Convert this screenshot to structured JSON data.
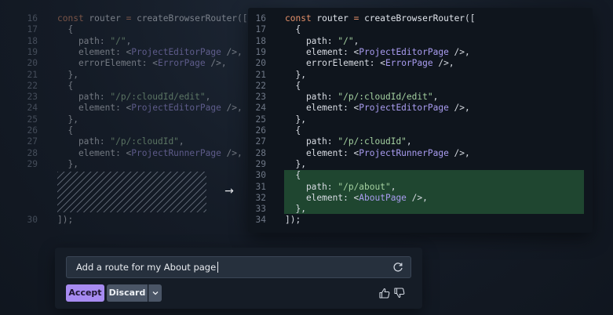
{
  "left_diff": {
    "lines": [
      {
        "num": "16",
        "tokens": [
          {
            "c": "kw",
            "t": "const "
          },
          {
            "c": "id",
            "t": "router "
          },
          {
            "c": "kw",
            "t": "= "
          },
          {
            "c": "id",
            "t": "createBrowserRouter"
          },
          {
            "c": "plain",
            "t": "(["
          }
        ]
      },
      {
        "num": "17",
        "tokens": [
          {
            "c": "plain",
            "t": "  {"
          }
        ]
      },
      {
        "num": "18",
        "tokens": [
          {
            "c": "plain",
            "t": "    path: "
          },
          {
            "c": "str",
            "t": "\"/\""
          },
          {
            "c": "plain",
            "t": ","
          }
        ]
      },
      {
        "num": "19",
        "tokens": [
          {
            "c": "plain",
            "t": "    element: <"
          },
          {
            "c": "tag",
            "t": "ProjectEditorPage"
          },
          {
            "c": "plain",
            "t": " />,"
          }
        ]
      },
      {
        "num": "20",
        "tokens": [
          {
            "c": "plain",
            "t": "    errorElement: <"
          },
          {
            "c": "tag",
            "t": "ErrorPage"
          },
          {
            "c": "plain",
            "t": " />,"
          }
        ]
      },
      {
        "num": "21",
        "tokens": [
          {
            "c": "plain",
            "t": "  },"
          }
        ]
      },
      {
        "num": "22",
        "tokens": [
          {
            "c": "plain",
            "t": "  {"
          }
        ]
      },
      {
        "num": "23",
        "tokens": [
          {
            "c": "plain",
            "t": "    path: "
          },
          {
            "c": "str",
            "t": "\"/p/:cloudId/edit\""
          },
          {
            "c": "plain",
            "t": ","
          }
        ]
      },
      {
        "num": "24",
        "tokens": [
          {
            "c": "plain",
            "t": "    element: <"
          },
          {
            "c": "tag",
            "t": "ProjectEditorPage"
          },
          {
            "c": "plain",
            "t": " />,"
          }
        ]
      },
      {
        "num": "25",
        "tokens": [
          {
            "c": "plain",
            "t": "  },"
          }
        ]
      },
      {
        "num": "26",
        "tokens": [
          {
            "c": "plain",
            "t": "  {"
          }
        ]
      },
      {
        "num": "27",
        "tokens": [
          {
            "c": "plain",
            "t": "    path: "
          },
          {
            "c": "str",
            "t": "\"/p/:cloudId\""
          },
          {
            "c": "plain",
            "t": ","
          }
        ]
      },
      {
        "num": "28",
        "tokens": [
          {
            "c": "plain",
            "t": "    element: <"
          },
          {
            "c": "tag",
            "t": "ProjectRunnerPage"
          },
          {
            "c": "plain",
            "t": " />,"
          }
        ]
      },
      {
        "num": "29",
        "tokens": [
          {
            "c": "plain",
            "t": "  },"
          }
        ]
      },
      {
        "num": "30",
        "tokens": [
          {
            "c": "plain",
            "t": "]);"
          }
        ]
      }
    ]
  },
  "right_diff": {
    "lines": [
      {
        "num": "16",
        "tokens": [
          {
            "c": "kw",
            "t": "const "
          },
          {
            "c": "id",
            "t": "router "
          },
          {
            "c": "kw",
            "t": "= "
          },
          {
            "c": "id",
            "t": "createBrowserRouter"
          },
          {
            "c": "plain",
            "t": "(["
          }
        ]
      },
      {
        "num": "17",
        "tokens": [
          {
            "c": "plain",
            "t": "  {"
          }
        ]
      },
      {
        "num": "18",
        "tokens": [
          {
            "c": "plain",
            "t": "    path: "
          },
          {
            "c": "str",
            "t": "\"/\""
          },
          {
            "c": "plain",
            "t": ","
          }
        ]
      },
      {
        "num": "19",
        "tokens": [
          {
            "c": "plain",
            "t": "    element: <"
          },
          {
            "c": "tag",
            "t": "ProjectEditorPage"
          },
          {
            "c": "plain",
            "t": " />,"
          }
        ]
      },
      {
        "num": "20",
        "tokens": [
          {
            "c": "plain",
            "t": "    errorElement: <"
          },
          {
            "c": "tag",
            "t": "ErrorPage"
          },
          {
            "c": "plain",
            "t": " />,"
          }
        ]
      },
      {
        "num": "21",
        "tokens": [
          {
            "c": "plain",
            "t": "  },"
          }
        ]
      },
      {
        "num": "22",
        "tokens": [
          {
            "c": "plain",
            "t": "  {"
          }
        ]
      },
      {
        "num": "23",
        "tokens": [
          {
            "c": "plain",
            "t": "    path: "
          },
          {
            "c": "str",
            "t": "\"/p/:cloudId/edit\""
          },
          {
            "c": "plain",
            "t": ","
          }
        ]
      },
      {
        "num": "24",
        "tokens": [
          {
            "c": "plain",
            "t": "    element: <"
          },
          {
            "c": "tag",
            "t": "ProjectEditorPage"
          },
          {
            "c": "plain",
            "t": " />,"
          }
        ]
      },
      {
        "num": "25",
        "tokens": [
          {
            "c": "plain",
            "t": "  },"
          }
        ]
      },
      {
        "num": "26",
        "tokens": [
          {
            "c": "plain",
            "t": "  {"
          }
        ]
      },
      {
        "num": "27",
        "tokens": [
          {
            "c": "plain",
            "t": "    path: "
          },
          {
            "c": "str",
            "t": "\"/p/:cloudId\""
          },
          {
            "c": "plain",
            "t": ","
          }
        ]
      },
      {
        "num": "28",
        "tokens": [
          {
            "c": "plain",
            "t": "    element: <"
          },
          {
            "c": "tag",
            "t": "ProjectRunnerPage"
          },
          {
            "c": "plain",
            "t": " />,"
          }
        ]
      },
      {
        "num": "29",
        "tokens": [
          {
            "c": "plain",
            "t": "  },"
          }
        ]
      },
      {
        "num": "30",
        "added": true,
        "tokens": [
          {
            "c": "plain",
            "t": "  {"
          }
        ]
      },
      {
        "num": "31",
        "added": true,
        "tokens": [
          {
            "c": "plain",
            "t": "    path: "
          },
          {
            "c": "str",
            "t": "\"/p/about\""
          },
          {
            "c": "plain",
            "t": ","
          }
        ]
      },
      {
        "num": "32",
        "added": true,
        "tokens": [
          {
            "c": "plain",
            "t": "    element: <"
          },
          {
            "c": "tag",
            "t": "AboutPage"
          },
          {
            "c": "plain",
            "t": " />,"
          }
        ]
      },
      {
        "num": "33",
        "added": true,
        "tokens": [
          {
            "c": "plain",
            "t": "  },"
          }
        ]
      },
      {
        "num": "34",
        "tokens": [
          {
            "c": "plain",
            "t": "]);"
          }
        ]
      }
    ]
  },
  "prompt": {
    "text": "Add a route for my About page",
    "refresh_icon": "refresh-icon"
  },
  "actions": {
    "accept_label": "Accept",
    "discard_label": "Discard",
    "menu_icon": "chevron-down-icon",
    "thumbs_up_icon": "thumbs-up-icon",
    "thumbs_down_icon": "thumbs-down-icon"
  },
  "colors": {
    "accent": "#a78bf1",
    "added_line_bg": "#1f4630",
    "keyword": "#e38f69",
    "string": "#a4d1a0",
    "component": "#a99cf0"
  }
}
